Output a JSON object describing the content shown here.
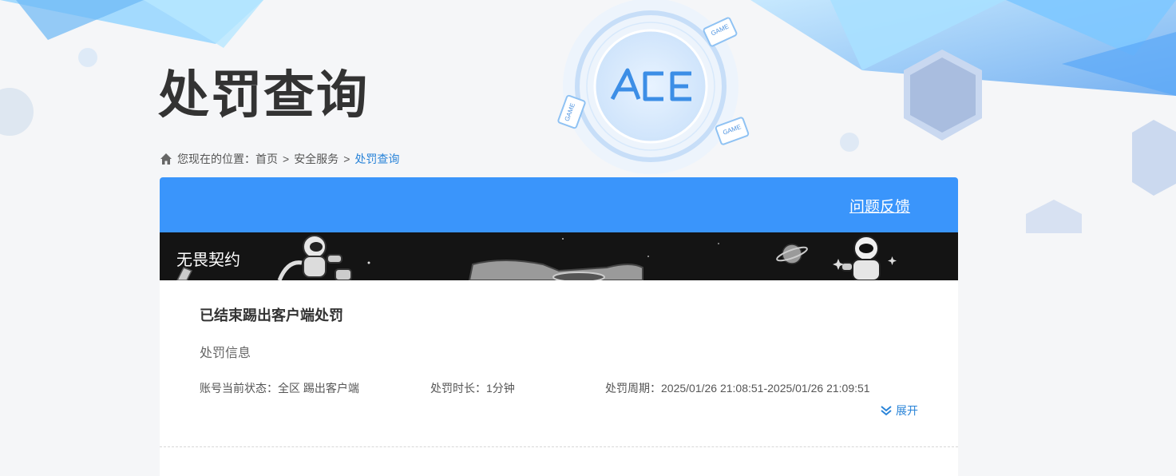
{
  "page": {
    "title": "处罚查询"
  },
  "breadcrumb": {
    "prefix": "您现在的位置：",
    "items": [
      "首页",
      "安全服务"
    ],
    "current": "处罚查询",
    "separator": ">"
  },
  "panel": {
    "feedback_label": "问题反馈",
    "header_color": "#3a95fb"
  },
  "game": {
    "name": "无畏契约"
  },
  "record": {
    "title": "已结束踢出客户端处罚",
    "section_label": "处罚信息",
    "status": "账号当前状态：全区 踢出客户端",
    "duration": "处罚时长：1分钟",
    "period": "处罚周期：2025/01/26 21:08:51-2025/01/26 21:09:51",
    "expand_label": "展开"
  },
  "logo": {
    "text": "ACE",
    "badge": "GAME"
  },
  "colors": {
    "accent": "#2a84d8",
    "background": "#f5f6f8"
  }
}
